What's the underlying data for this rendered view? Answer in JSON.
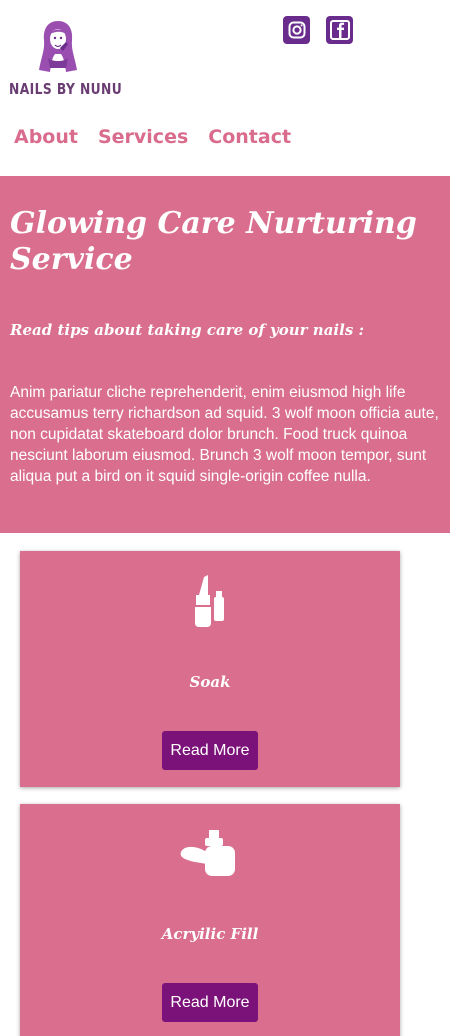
{
  "brand": {
    "name": "NAILS BY NUNU"
  },
  "social": [
    {
      "icon": "instagram-icon"
    },
    {
      "icon": "facebook-icon"
    }
  ],
  "nav": {
    "items": [
      "About",
      "Services",
      "Contact"
    ]
  },
  "hero": {
    "title": "Glowing Care Nurturing Service",
    "subtitle": "Read tips about taking care of your nails :",
    "body": "Anim pariatur cliche reprehenderit, enim eiusmod high life accusamus terry richardson ad squid. 3 wolf moon officia aute, non cupidatat skateboard dolor brunch. Food truck quinoa nesciunt laborum eiusmod. Brunch 3 wolf moon tempor, sunt aliqua put a bird on it squid single-origin coffee nulla."
  },
  "cards": [
    {
      "title": "Soak",
      "icon": "nail-polish-icon",
      "button": "Read More"
    },
    {
      "title": "Acryilic Fill",
      "icon": "nail-polish-tipped-icon",
      "button": "Read More"
    }
  ],
  "colors": {
    "primary": "#d96e8f",
    "accent": "#7b1279",
    "brand": "#6a3d73"
  }
}
